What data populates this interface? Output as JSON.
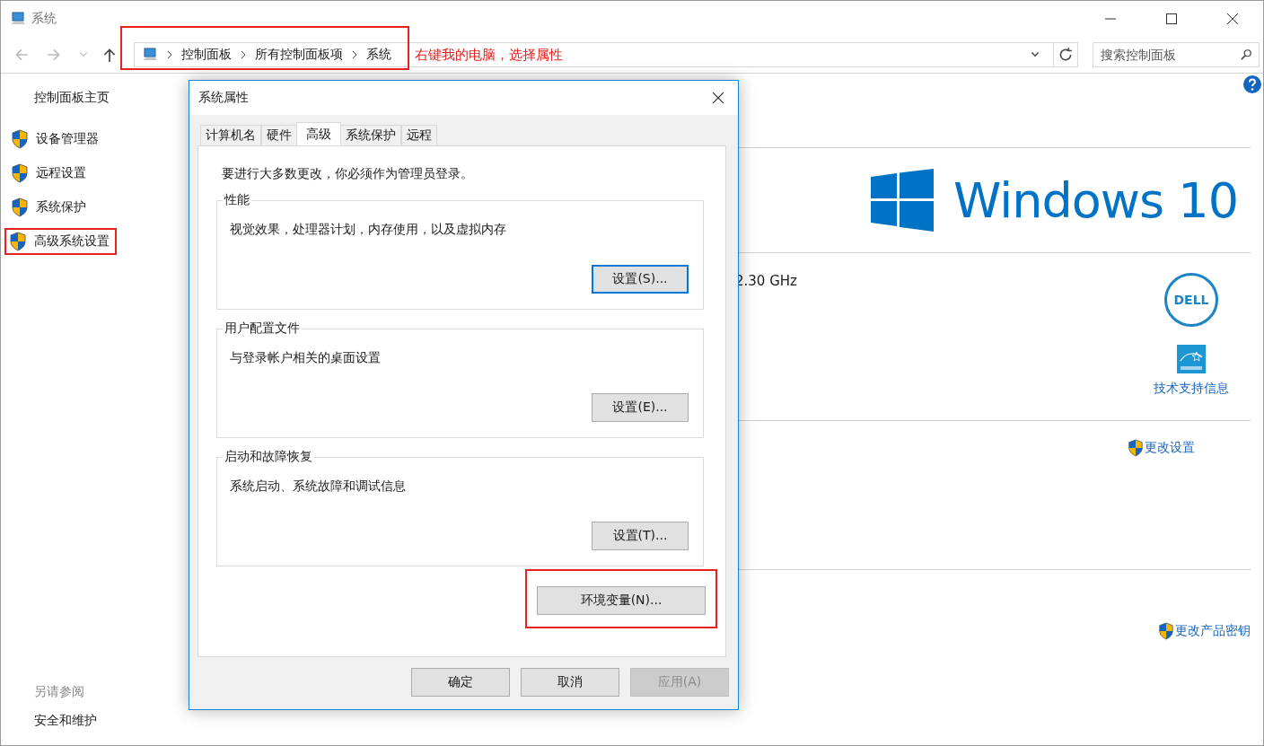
{
  "window": {
    "title": "系统"
  },
  "nav": {
    "breadcrumb": [
      "控制面板",
      "所有控制面板项",
      "系统"
    ],
    "search": {
      "placeholder": "搜索控制面板"
    }
  },
  "annotation": {
    "text": "右键我的电脑，选择属性"
  },
  "sidebar": {
    "home": "控制面板主页",
    "items": [
      {
        "label": "设备管理器",
        "highlighted": false
      },
      {
        "label": "远程设置",
        "highlighted": false
      },
      {
        "label": "系统保护",
        "highlighted": false
      },
      {
        "label": "高级系统设置",
        "highlighted": true
      }
    ],
    "see_also": {
      "heading": "另请参阅",
      "items": [
        "安全和维护"
      ]
    }
  },
  "main": {
    "logo_text": "Windows 10",
    "processor_speed": "2.30 GHz",
    "maker_logo": "DELL",
    "support_link": "技术支持信息",
    "change_settings": "更改设置",
    "change_key": "更改产品密钥"
  },
  "dialog": {
    "title": "系统属性",
    "tabs": [
      {
        "label": "计算机名",
        "selected": false
      },
      {
        "label": "硬件",
        "selected": false
      },
      {
        "label": "高级",
        "selected": true
      },
      {
        "label": "系统保护",
        "selected": false
      },
      {
        "label": "远程",
        "selected": false
      }
    ],
    "notice": "要进行大多数更改，你必须作为管理员登录。",
    "groups": [
      {
        "title": "性能",
        "description": "视觉效果，处理器计划，内存使用，以及虚拟内存",
        "button": "设置(S)...",
        "focused": true
      },
      {
        "title": "用户配置文件",
        "description": "与登录帐户相关的桌面设置",
        "button": "设置(E)...",
        "focused": false
      },
      {
        "title": "启动和故障恢复",
        "description": "系统启动、系统故障和调试信息",
        "button": "设置(T)...",
        "focused": false
      }
    ],
    "env_button": {
      "label": "环境变量(N)...",
      "highlighted": true
    },
    "buttons": [
      {
        "label": "确定",
        "disabled": false
      },
      {
        "label": "取消",
        "disabled": false
      },
      {
        "label": "应用(A)",
        "disabled": true
      }
    ]
  }
}
